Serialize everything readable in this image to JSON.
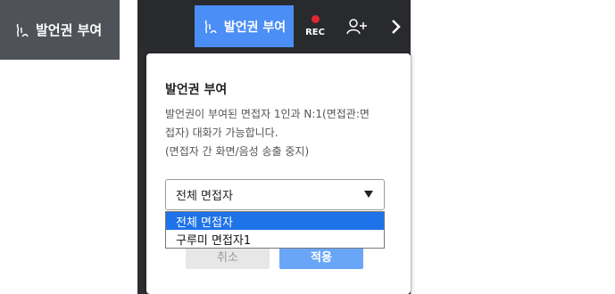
{
  "chip": {
    "label": "발언권 부여",
    "icon": "speak-permission-icon"
  },
  "toolbar": {
    "speak_label": "발언권 부여",
    "speak_icon": "speak-permission-icon",
    "rec_label": "REC",
    "rec_color": "#e0292f",
    "add_icon": "add-person-icon",
    "next_icon": "chevron-right-icon",
    "accent": "#4b8ef5"
  },
  "popup": {
    "title": "발언권 부여",
    "desc_line1": "발언권이 부여된 면접자 1인과 N:1(면접관:면",
    "desc_line2": "접자) 대화가 가능합니다.",
    "desc_line3": "(면접자 간 화면/음성 송출 중지)",
    "select_value": "전체 면접자",
    "options": [
      "전체 면접자",
      "구루미 면접자1"
    ],
    "cancel_label": "취소",
    "apply_label": "적용"
  }
}
